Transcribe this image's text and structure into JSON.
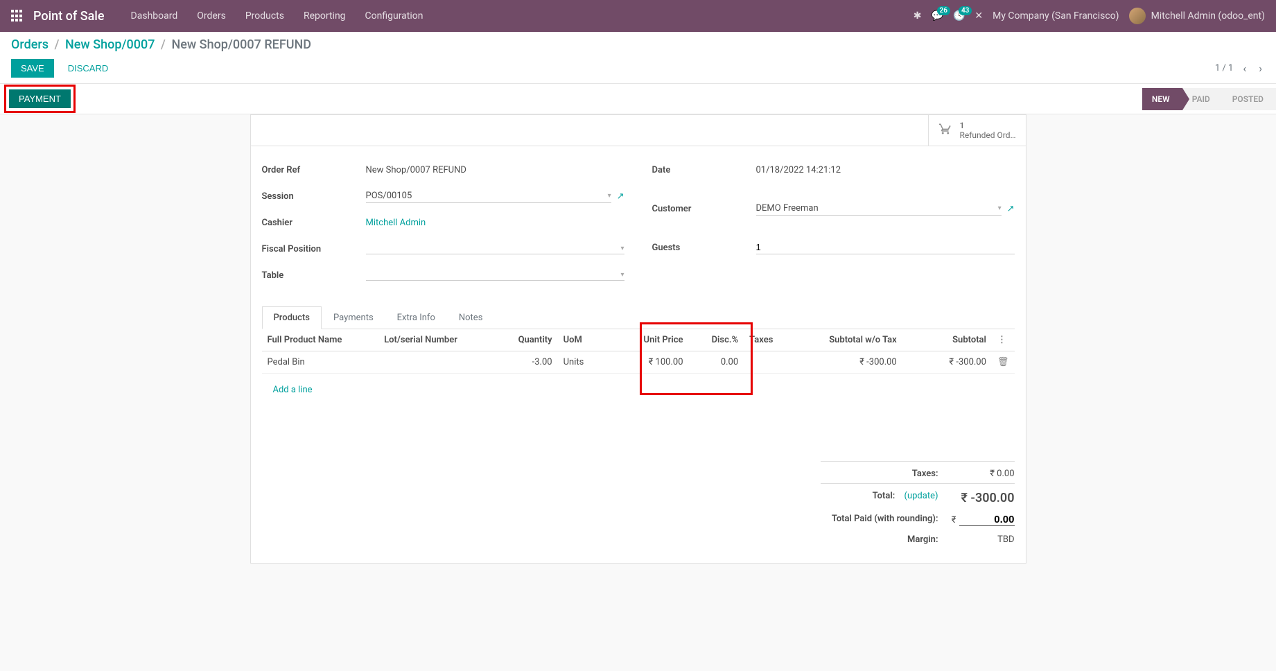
{
  "nav": {
    "brand": "Point of Sale",
    "items": [
      "Dashboard",
      "Orders",
      "Products",
      "Reporting",
      "Configuration"
    ],
    "msg_badge": "26",
    "act_badge": "43",
    "company": "My Company (San Francisco)",
    "user": "Mitchell Admin (odoo_ent)"
  },
  "breadcrumb": {
    "orders": "Orders",
    "parent": "New Shop/0007",
    "current": "New Shop/0007 REFUND"
  },
  "actions": {
    "save": "SAVE",
    "discard": "DISCARD",
    "payment": "PAYMENT"
  },
  "pager": {
    "text": "1 / 1"
  },
  "status": {
    "new": "NEW",
    "paid": "PAID",
    "posted": "POSTED"
  },
  "stat": {
    "count": "1",
    "label": "Refunded Ord…"
  },
  "form": {
    "order_ref_label": "Order Ref",
    "order_ref": "New Shop/0007 REFUND",
    "session_label": "Session",
    "session": "POS/00105",
    "cashier_label": "Cashier",
    "cashier": "Mitchell Admin",
    "fiscal_label": "Fiscal Position",
    "fiscal": "",
    "table_label": "Table",
    "table": "",
    "date_label": "Date",
    "date": "01/18/2022 14:21:12",
    "customer_label": "Customer",
    "customer": "DEMO Freeman",
    "guests_label": "Guests",
    "guests": "1"
  },
  "tabs": [
    "Products",
    "Payments",
    "Extra Info",
    "Notes"
  ],
  "table": {
    "headers": {
      "product": "Full Product Name",
      "lot": "Lot/serial Number",
      "qty": "Quantity",
      "uom": "UoM",
      "unit_price": "Unit Price",
      "disc": "Disc.%",
      "taxes": "Taxes",
      "subtotal_wo": "Subtotal w/o Tax",
      "subtotal": "Subtotal"
    },
    "rows": [
      {
        "product": "Pedal Bin",
        "lot": "",
        "qty": "-3.00",
        "uom": "Units",
        "unit_price": "₹ 100.00",
        "disc": "0.00",
        "taxes": "",
        "subtotal_wo": "₹ -300.00",
        "subtotal": "₹ -300.00"
      }
    ],
    "add_line": "Add a line"
  },
  "totals": {
    "taxes_label": "Taxes:",
    "taxes_val": "₹ 0.00",
    "total_label": "Total:",
    "update": "(update)",
    "total_val": "₹ -300.00",
    "paid_label": "Total Paid (with rounding):",
    "paid_curr": "₹",
    "paid_val": "0.00",
    "margin_label": "Margin:",
    "margin_val": "TBD"
  }
}
